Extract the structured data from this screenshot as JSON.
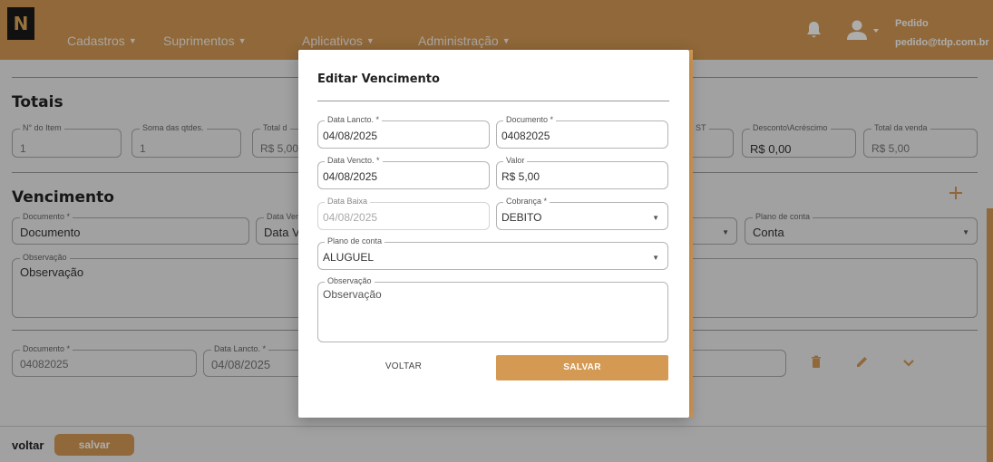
{
  "header": {
    "logo_letter": "N",
    "nav": [
      {
        "label": "Cadastros"
      },
      {
        "label": "Suprimentos"
      },
      {
        "label": "Aplicativos"
      },
      {
        "label": "Administração"
      }
    ],
    "user_name": "Pedido",
    "user_email": "pedido@tdp.com.br"
  },
  "totais": {
    "title": "Totais",
    "fields": [
      {
        "label": "N° do Item",
        "value": "1"
      },
      {
        "label": "Soma das qtdes.",
        "value": "1"
      },
      {
        "label": "Total d",
        "value": "R$ 5,00"
      },
      {
        "label": "ST",
        "value": ""
      },
      {
        "label": "Desconto\\Acréscimo",
        "value": "R$ 0,00"
      },
      {
        "label": "Total da venda",
        "value": "R$ 5,00"
      }
    ]
  },
  "vencimento": {
    "title": "Vencimento",
    "documento_label": "Documento *",
    "documento_placeholder": "Documento",
    "data_label": "Data Ver",
    "data_value": "Data V",
    "plano_label": "Plano de conta",
    "plano_value": "Conta",
    "obs_label": "Observação",
    "obs_placeholder": "Observação",
    "row": {
      "documento_label": "Documento *",
      "documento_value": "04082025",
      "data_lancto_label": "Data Lancto. *",
      "data_lancto_value": "04/08/2025"
    }
  },
  "footer": {
    "voltar": "voltar",
    "salvar": "salvar"
  },
  "modal": {
    "title": "Editar Vencimento",
    "data_lancto": {
      "label": "Data Lancto. *",
      "value": "04/08/2025"
    },
    "documento": {
      "label": "Documento *",
      "value": "04082025"
    },
    "data_vencto": {
      "label": "Data Vencto. *",
      "value": "04/08/2025"
    },
    "valor": {
      "label": "Valor",
      "value": "R$ 5,00"
    },
    "data_baixa": {
      "label": "Data Baixa",
      "value": "04/08/2025"
    },
    "cobranca": {
      "label": "Cobrança *",
      "value": "DEBITO"
    },
    "plano_conta": {
      "label": "Plano de conta",
      "value": "ALUGUEL"
    },
    "observacao": {
      "label": "Observação",
      "placeholder": "Observação"
    },
    "voltar_label": "VOLTAR",
    "salvar_label": "SALVAR"
  },
  "colors": {
    "accent": "#d49a54",
    "overlay": "rgba(0,0,0,0.32)"
  },
  "icons": [
    "bell-icon",
    "user-icon",
    "plus-icon",
    "trash-icon",
    "pencil-icon",
    "chevron-down-icon"
  ]
}
